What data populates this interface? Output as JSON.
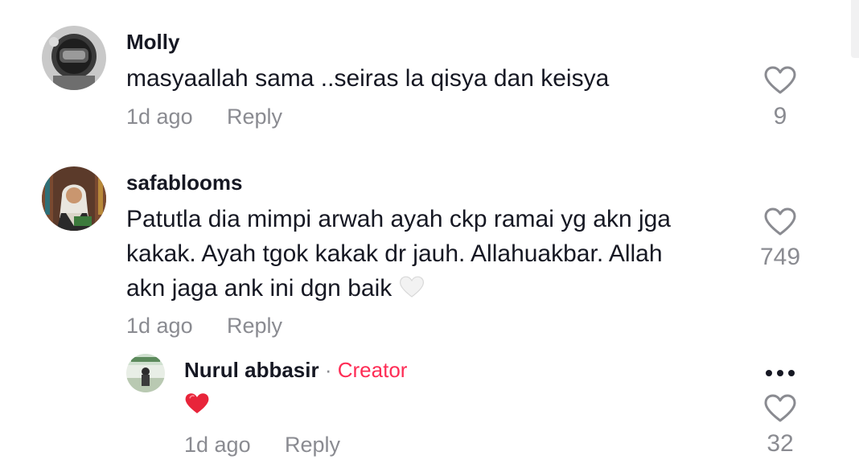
{
  "comments": [
    {
      "username": "Molly",
      "text": "masyaallah sama ..seiras la qisya dan keisya",
      "time": "1d ago",
      "reply_label": "Reply",
      "likes": "9"
    },
    {
      "username": "safablooms",
      "text_lines": [
        "Patutla dia mimpi arwah ayah ckp ramai yg akn jga",
        "kakak. Ayah tgok kakak dr jauh. Allahuakbar. Allah",
        "akn jaga ank ini dgn baik"
      ],
      "trailing_emoji": "white-heart",
      "time": "1d ago",
      "reply_label": "Reply",
      "likes": "749"
    }
  ],
  "reply": {
    "username": "Nurul abbasir",
    "separator": "·",
    "badge": "Creator",
    "emoji": "red-heart",
    "time": "1d ago",
    "reply_label": "Reply",
    "likes": "32"
  },
  "colors": {
    "text": "#161823",
    "muted": "#8a8b91",
    "creator": "#fe2c55",
    "red_heart": "#e8243a"
  }
}
